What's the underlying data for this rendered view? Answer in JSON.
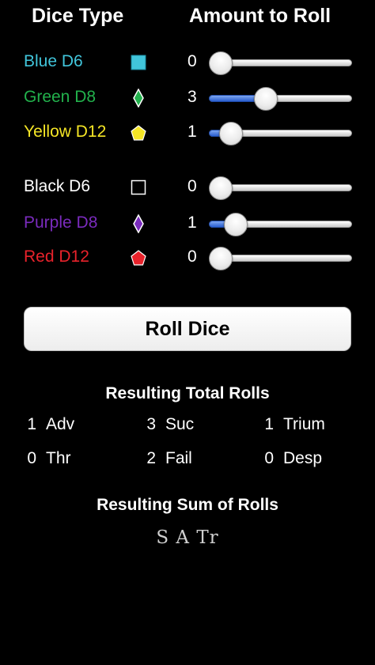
{
  "header": {
    "dice_type": "Dice Type",
    "amount_to_roll": "Amount to Roll"
  },
  "dice": [
    {
      "label": "Blue D6",
      "color": "#41c5db",
      "icon": "blue-square-icon",
      "count": "0",
      "fraction": 0.0
    },
    {
      "label": "Green D8",
      "color": "#22b14c",
      "icon": "green-diamond-icon",
      "count": "3",
      "fraction": 0.375
    },
    {
      "label": "Yellow D12",
      "color": "#f5e626",
      "icon": "yellow-pentagon-icon",
      "count": "1",
      "fraction": 0.083
    },
    {
      "label": "Black D6",
      "color": "#ffffff",
      "icon": "black-square-icon",
      "count": "0",
      "fraction": 0.0
    },
    {
      "label": "Purple D8",
      "color": "#7a2bbd",
      "icon": "purple-diamond-icon",
      "count": "1",
      "fraction": 0.125
    },
    {
      "label": "Red D12",
      "color": "#e8222b",
      "icon": "red-pentagon-icon",
      "count": "0",
      "fraction": 0.0
    }
  ],
  "roll_button": "Roll Dice",
  "totals": {
    "title": "Resulting Total Rolls",
    "items": [
      {
        "n": "1",
        "label": "Adv"
      },
      {
        "n": "3",
        "label": "Suc"
      },
      {
        "n": "1",
        "label": "Trium"
      },
      {
        "n": "0",
        "label": "Thr"
      },
      {
        "n": "2",
        "label": "Fail"
      },
      {
        "n": "0",
        "label": "Desp"
      }
    ]
  },
  "sum": {
    "title": "Resulting Sum of Rolls",
    "value": "S A Tr"
  }
}
